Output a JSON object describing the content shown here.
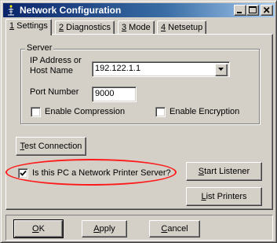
{
  "window": {
    "title": "Network Configuration"
  },
  "tabs": [
    {
      "mnemonic": "1",
      "text": " Settings"
    },
    {
      "mnemonic": "2",
      "text": " Diagnostics"
    },
    {
      "mnemonic": "3",
      "text": " Mode"
    },
    {
      "mnemonic": "4",
      "text": " Netsetup"
    }
  ],
  "server": {
    "group_title": "Server",
    "ip_label_line1": "IP Address or",
    "ip_label_line2": "Host Name",
    "ip_value": "192.122.1.1",
    "port_label": "Port Number",
    "port_value": "9000",
    "compression_label": "Enable Compression",
    "compression_checked": false,
    "encryption_label": "Enable Encryption",
    "encryption_checked": false
  },
  "buttons": {
    "test_connection": {
      "mnemonic": "T",
      "rest": "est Connection"
    },
    "start_listener": {
      "mnemonic": "S",
      "rest": "tart Listener"
    },
    "list_printers": {
      "mnemonic": "L",
      "rest": "ist Printers"
    },
    "ok": {
      "mnemonic": "O",
      "rest": "K"
    },
    "apply": {
      "mnemonic": "A",
      "rest": "pply"
    },
    "cancel": {
      "mnemonic": "C",
      "rest": "ancel"
    }
  },
  "printer_server": {
    "label": "Is this PC a Network Printer Server?",
    "checked": true
  },
  "colors": {
    "highlight": "#ff1a1a",
    "titlebar_start": "#0a246a",
    "titlebar_end": "#a6caf0"
  },
  "icons": [
    "network-app-icon",
    "minimize-icon",
    "maximize-icon",
    "close-icon",
    "dropdown-arrow-icon",
    "checkmark-icon"
  ]
}
